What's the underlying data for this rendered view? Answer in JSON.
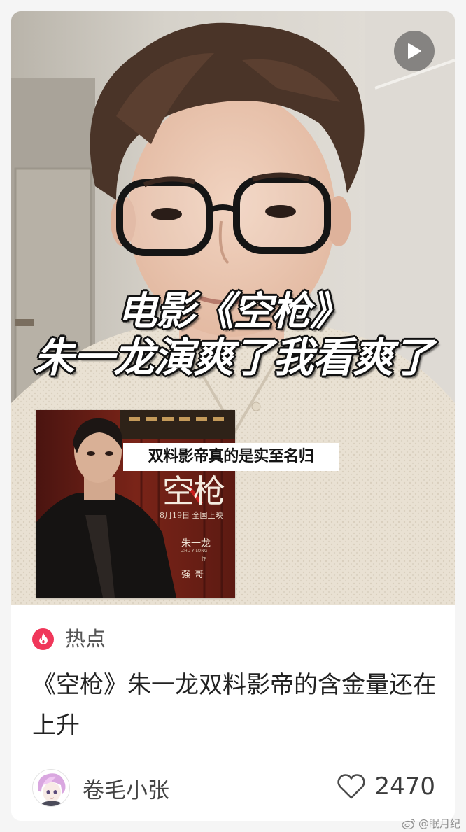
{
  "cover": {
    "caption_line1": "电影《空枪》",
    "caption_line2": "朱一龙演爽了我看爽了",
    "overlay_banner": "双料影帝真的是实至名归",
    "poster": {
      "title": "空枪",
      "release": "8月19日 全国上映",
      "actor": "朱一龙",
      "actor_en": "ZHU YILONG",
      "role_prefix": "饰",
      "role": "强哥"
    },
    "play_icon": "play-icon"
  },
  "post": {
    "tag_icon": "fire-icon",
    "tag_label": "热点",
    "title": "《空枪》朱一龙双料影帝的含金量还在上升",
    "author_name": "卷毛小张",
    "like_icon": "heart-outline-icon",
    "like_count": "2470"
  },
  "watermark": {
    "icon": "weibo-icon",
    "text": "@眠月纪"
  },
  "colors": {
    "accent_red": "#f0375a",
    "card_bg": "#ffffff",
    "page_bg": "#f5f5f5"
  }
}
